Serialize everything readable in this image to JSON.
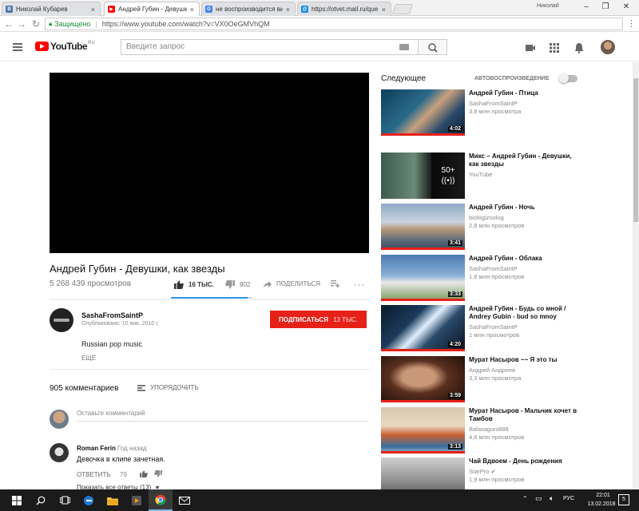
{
  "browser": {
    "tabs": [
      {
        "title": "Николай Кубарев",
        "favicon": "vk-icon",
        "color": "#4a76a8",
        "glyph": "B"
      },
      {
        "title": "Андрей Губин - Девушк",
        "favicon": "youtube-icon",
        "color": "#ff0000",
        "glyph": "▶"
      },
      {
        "title": "не воспроизводится ви",
        "favicon": "google-icon",
        "color": "#4285f4",
        "glyph": "G"
      },
      {
        "title": "https://otvet.mail.ru/que",
        "favicon": "mail-ru-icon",
        "color": "#168de2",
        "glyph": "@"
      }
    ],
    "profile_name": "Николай",
    "secure_label": "Защищено",
    "url": "https://www.youtube.com/watch?v=VX0OeGMVhQM"
  },
  "youtube": {
    "logo_text": "YouTube",
    "logo_region": "RU",
    "search_placeholder": "Введите запрос",
    "accent": "#ff0000"
  },
  "video": {
    "title": "Андрей Губин - Девушки, как звезды",
    "views": "5 268 439 просмотров",
    "likes": "16 ТЫС.",
    "dislikes": "802",
    "like_ratio": 0.95,
    "share_label": "ПОДЕЛИТЬСЯ",
    "channel": "SashaFromSaintP",
    "published": "Опубликовано: 10 янв. 2010 г.",
    "subscribe_label": "ПОДПИСАТЬСЯ",
    "subscribers": "13 ТЫС.",
    "description": "Russian pop music",
    "more_label": "ЕЩЁ"
  },
  "comments": {
    "count": "905 комментариев",
    "sort_label": "УПОРЯДОЧИТЬ",
    "input_placeholder": "Оставьте комментарий",
    "items": [
      {
        "author": "Roman Ferin",
        "time": "Год назад",
        "text": "Девочка в клипе зачетная.",
        "reply_label": "ОТВЕТИТЬ",
        "likes": "79",
        "show_replies": "Показать все ответы (13)"
      }
    ]
  },
  "sidebar": {
    "up_next": "Следующее",
    "autoplay_label": "АВТОВОСПРОИЗВЕДЕНИЕ",
    "items": [
      {
        "title": "Андрей Губин - Птица",
        "channel": "SashaFromSaintP",
        "views": "3,6 млн просмотра",
        "duration": "4:02"
      },
      {
        "title": "Микс – Андрей Губин - Девушки, как звезды",
        "channel": "YouTube",
        "views": "",
        "duration": "",
        "mix_count": "50+"
      },
      {
        "title": "Андрей Губин - Ночь",
        "channel": "biologizoolog",
        "views": "2,8 млн просмотров",
        "duration": "3:41"
      },
      {
        "title": "Андрей Губин - Облака",
        "channel": "SashaFromSaintP",
        "views": "1,8 млн просмотров",
        "duration": "3:33"
      },
      {
        "title": "Андрей Губин - Будь со мной / Andrey Gubin - bud so mnoy",
        "channel": "SashaFromSaintP",
        "views": "1 млн просмотров",
        "duration": "4:20"
      },
      {
        "title": "Мурат Насыров ~~ Я это ты",
        "channel": "Андрей Андреев",
        "views": "3,3 млн просмотра",
        "duration": "3:59"
      },
      {
        "title": "Мурат Насыров - Мальчик хочет в Тамбов",
        "channel": "Balasaguni888",
        "views": "4,6 млн просмотров",
        "duration": "3:13"
      },
      {
        "title": "Чай Вдвоем - День рождения",
        "channel": "StarPro",
        "views": "1,9 млн просмотров",
        "duration": ""
      }
    ]
  },
  "taskbar": {
    "lang": "РУС",
    "time": "22:01",
    "date": "13.02.2018",
    "notifications": "5"
  }
}
